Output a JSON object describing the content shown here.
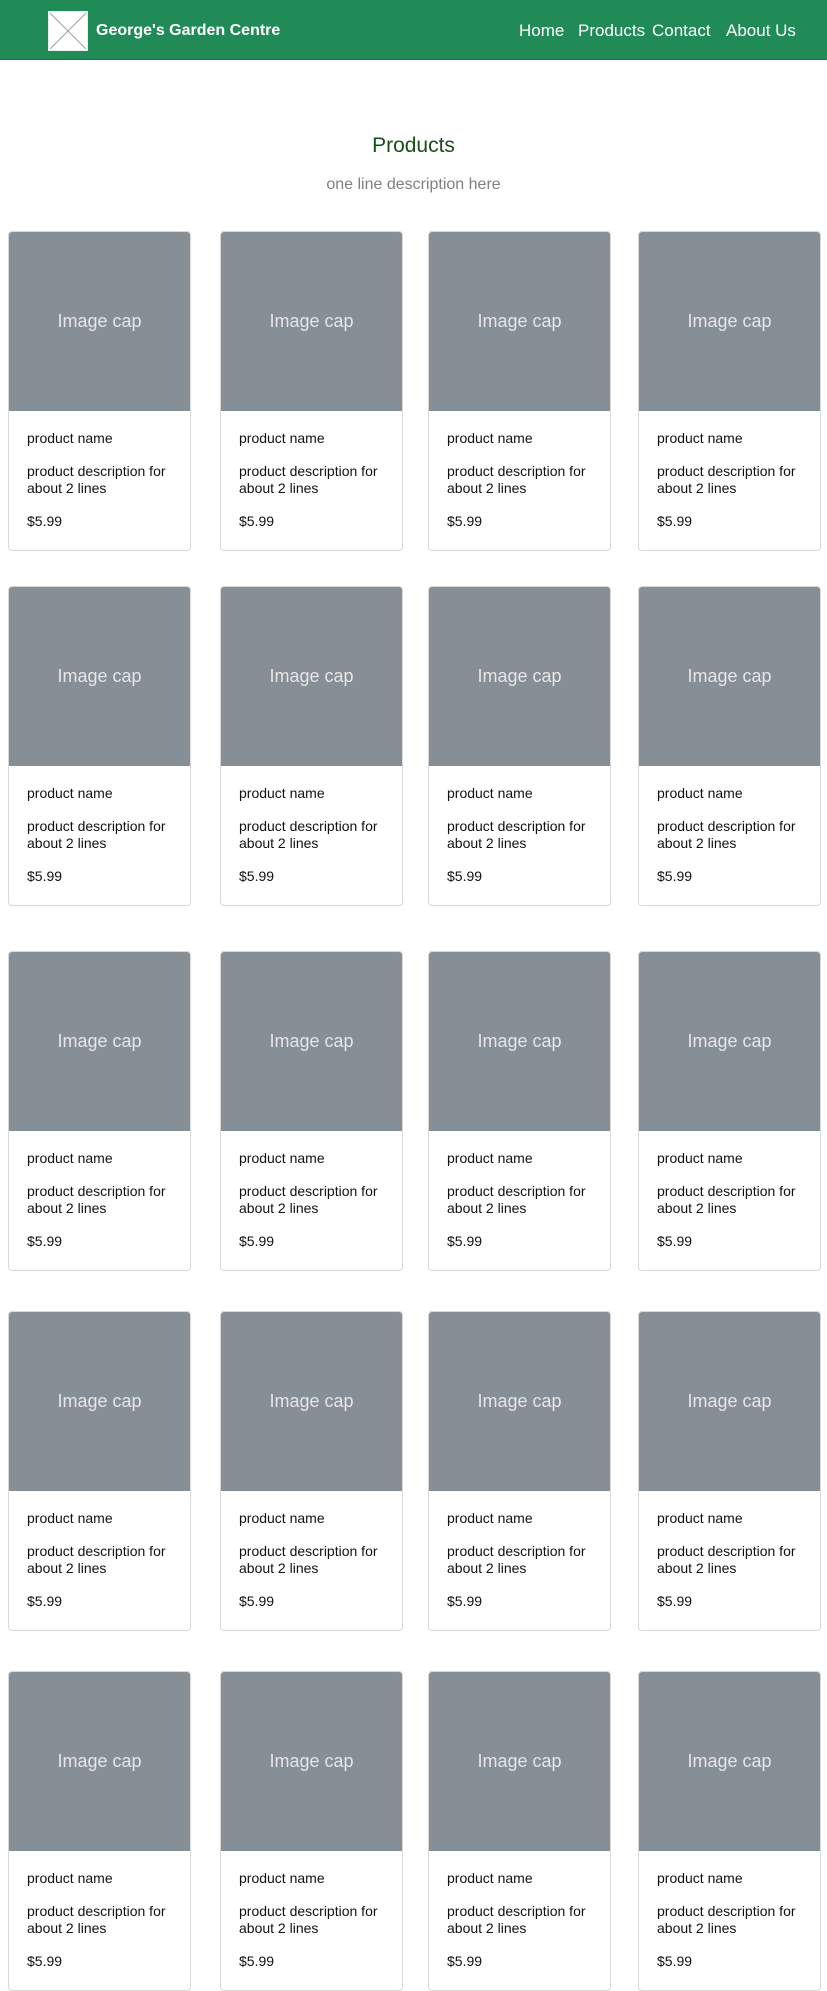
{
  "header": {
    "brand_name": "George's Garden Centre",
    "logo_icon": "image-placeholder-icon",
    "nav": [
      {
        "label": "Home"
      },
      {
        "label": "Products"
      },
      {
        "label": "Contact"
      },
      {
        "label": "About Us"
      }
    ],
    "bar_color": "#218b57"
  },
  "main": {
    "title": "Products",
    "subtitle": "one line description here",
    "products": [
      {
        "image_cap": "Image cap",
        "name": "product name",
        "description": "product description for about 2 lines",
        "price": "$5.99"
      },
      {
        "image_cap": "Image cap",
        "name": "product name",
        "description": "product description for about 2 lines",
        "price": "$5.99"
      },
      {
        "image_cap": "Image cap",
        "name": "product name",
        "description": "product description for about 2 lines",
        "price": "$5.99"
      },
      {
        "image_cap": "Image cap",
        "name": "product name",
        "description": "product description for about 2 lines",
        "price": "$5.99"
      },
      {
        "image_cap": "Image cap",
        "name": "product name",
        "description": "product description for about 2 lines",
        "price": "$5.99"
      },
      {
        "image_cap": "Image cap",
        "name": "product name",
        "description": "product description for about 2 lines",
        "price": "$5.99"
      },
      {
        "image_cap": "Image cap",
        "name": "product name",
        "description": "product description for about 2 lines",
        "price": "$5.99"
      },
      {
        "image_cap": "Image cap",
        "name": "product name",
        "description": "product description for about 2 lines",
        "price": "$5.99"
      },
      {
        "image_cap": "Image cap",
        "name": "product name",
        "description": "product description for about 2 lines",
        "price": "$5.99"
      },
      {
        "image_cap": "Image cap",
        "name": "product name",
        "description": "product description for about 2 lines",
        "price": "$5.99"
      },
      {
        "image_cap": "Image cap",
        "name": "product name",
        "description": "product description for about 2 lines",
        "price": "$5.99"
      },
      {
        "image_cap": "Image cap",
        "name": "product name",
        "description": "product description for about 2 lines",
        "price": "$5.99"
      },
      {
        "image_cap": "Image cap",
        "name": "product name",
        "description": "product description for about 2 lines",
        "price": "$5.99"
      },
      {
        "image_cap": "Image cap",
        "name": "product name",
        "description": "product description for about 2 lines",
        "price": "$5.99"
      },
      {
        "image_cap": "Image cap",
        "name": "product name",
        "description": "product description for about 2 lines",
        "price": "$5.99"
      },
      {
        "image_cap": "Image cap",
        "name": "product name",
        "description": "product description for about 2 lines",
        "price": "$5.99"
      },
      {
        "image_cap": "Image cap",
        "name": "product name",
        "description": "product description for about 2 lines",
        "price": "$5.99"
      },
      {
        "image_cap": "Image cap",
        "name": "product name",
        "description": "product description for about 2 lines",
        "price": "$5.99"
      },
      {
        "image_cap": "Image cap",
        "name": "product name",
        "description": "product description for about 2 lines",
        "price": "$5.99"
      },
      {
        "image_cap": "Image cap",
        "name": "product name",
        "description": "product description for about 2 lines",
        "price": "$5.99"
      }
    ]
  }
}
